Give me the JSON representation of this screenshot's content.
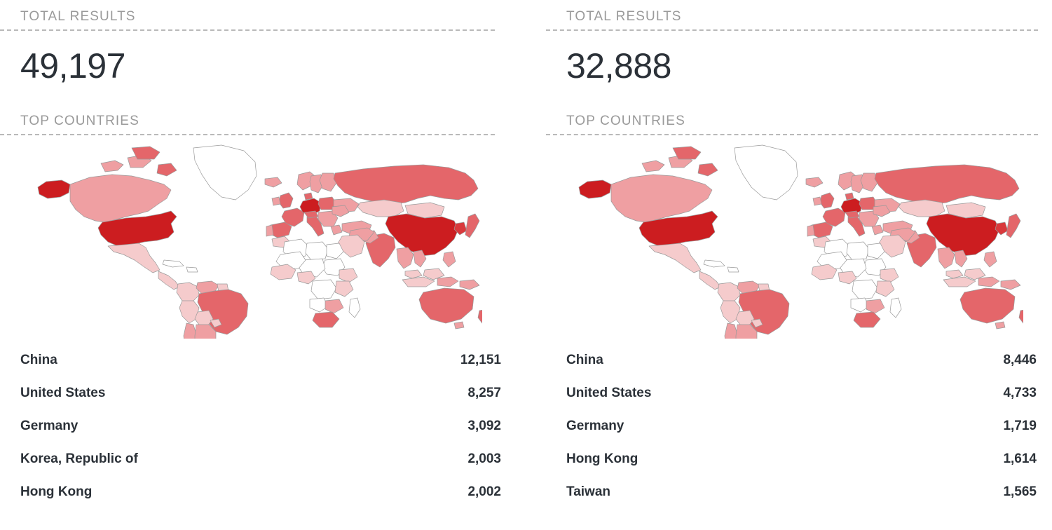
{
  "panels": [
    {
      "total_label": "TOTAL RESULTS",
      "total_value": "49,197",
      "countries_label": "TOP COUNTRIES",
      "rows": [
        {
          "name": "China",
          "value": "12,151"
        },
        {
          "name": "United States",
          "value": "8,257"
        },
        {
          "name": "Germany",
          "value": "3,092"
        },
        {
          "name": "Korea, Republic of",
          "value": "2,003"
        },
        {
          "name": "Hong Kong",
          "value": "2,002"
        }
      ]
    },
    {
      "total_label": "TOTAL RESULTS",
      "total_value": "32,888",
      "countries_label": "TOP COUNTRIES",
      "rows": [
        {
          "name": "China",
          "value": "8,446"
        },
        {
          "name": "United States",
          "value": "4,733"
        },
        {
          "name": "Germany",
          "value": "1,719"
        },
        {
          "name": "Hong Kong",
          "value": "1,614"
        },
        {
          "name": "Taiwan",
          "value": "1,565"
        }
      ]
    }
  ],
  "colors": {
    "label_gray": "#9a9a9a",
    "dash_gray": "#b9b9b9",
    "text_dark": "#2b3138",
    "scale_darkest": "#cc1d20",
    "scale_dark": "#d9393c",
    "scale_mid": "#e4666a",
    "scale_light": "#ef9fa2",
    "scale_pale": "#f5cbcc",
    "scale_none": "#ffffff",
    "map_stroke": "#9a9a9a"
  },
  "chart_data": [
    {
      "type": "map",
      "title": "TOP COUNTRIES",
      "total": 49197,
      "categories": [
        "China",
        "United States",
        "Germany",
        "Korea, Republic of",
        "Hong Kong"
      ],
      "values": [
        12151,
        8257,
        3092,
        2003,
        2002
      ],
      "legend": "choropleth intensity by result count",
      "colorscale": [
        "#ffffff",
        "#f5cbcc",
        "#ef9fa2",
        "#e4666a",
        "#d9393c",
        "#cc1d20"
      ]
    },
    {
      "type": "map",
      "title": "TOP COUNTRIES",
      "total": 32888,
      "categories": [
        "China",
        "United States",
        "Germany",
        "Hong Kong",
        "Taiwan"
      ],
      "values": [
        8446,
        4733,
        1719,
        1614,
        1565
      ],
      "legend": "choropleth intensity by result count",
      "colorscale": [
        "#ffffff",
        "#f5cbcc",
        "#ef9fa2",
        "#e4666a",
        "#d9393c",
        "#cc1d20"
      ]
    }
  ]
}
